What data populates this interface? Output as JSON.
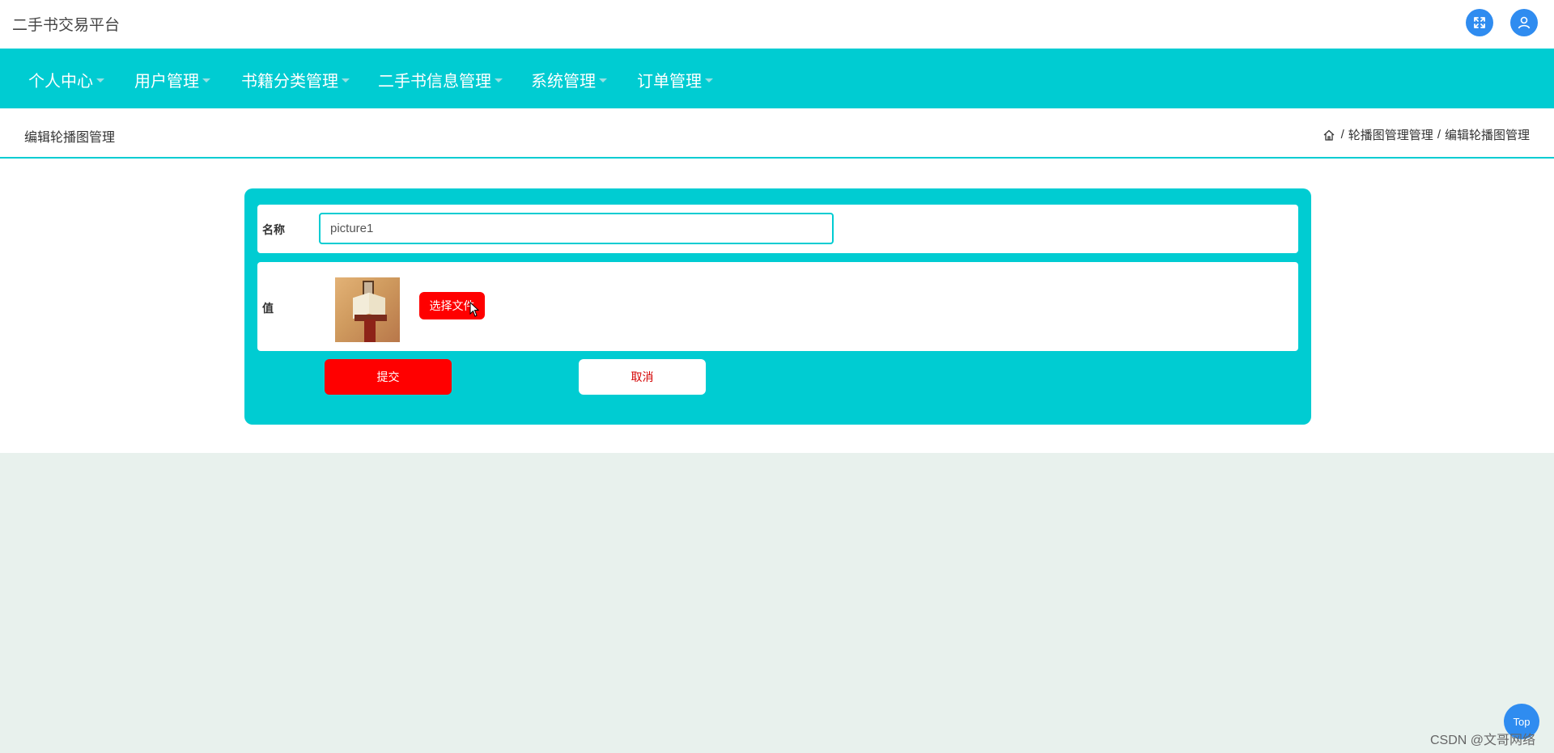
{
  "header": {
    "app_title": "二手书交易平台",
    "icons": [
      "fullscreen-icon",
      "user-icon"
    ],
    "icon_color": "#2f8cf0"
  },
  "nav": {
    "items": [
      {
        "label": "个人中心"
      },
      {
        "label": "用户管理"
      },
      {
        "label": "书籍分类管理"
      },
      {
        "label": "二手书信息管理"
      },
      {
        "label": "系统管理"
      },
      {
        "label": "订单管理"
      }
    ],
    "background": "#00ccd2"
  },
  "page": {
    "title": "编辑轮播图管理",
    "breadcrumb": {
      "home_icon": "home-icon",
      "separator": "/",
      "items": [
        "轮播图管理管理",
        "编辑轮播图管理"
      ]
    }
  },
  "form": {
    "name_label": "名称",
    "name_value": "picture1",
    "value_label": "值",
    "choose_file_label": "选择文件",
    "submit_label": "提交",
    "cancel_label": "取消"
  },
  "colors": {
    "accent": "#00ccd2",
    "primary_button": "#ff0000",
    "page_background": "#e8f1ed"
  },
  "floating": {
    "top_label": "Top"
  },
  "watermark": "CSDN @文哥网络"
}
